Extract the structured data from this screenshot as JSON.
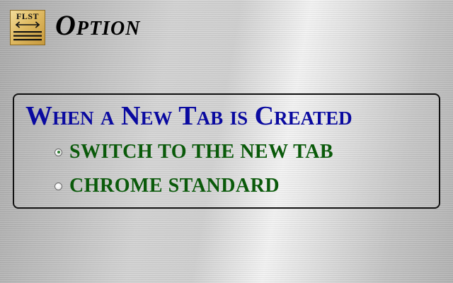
{
  "header": {
    "logo_text": "FLST",
    "title": "Option"
  },
  "setting": {
    "heading": "When a New Tab is Created",
    "options": [
      {
        "label": "SWITCH TO THE NEW TAB",
        "selected": true
      },
      {
        "label": "CHROME STANDARD",
        "selected": false
      }
    ]
  },
  "colors": {
    "heading": "#0a0aa0",
    "option_text": "#0a5a0a",
    "logo": "#e0bb63"
  },
  "icons": {
    "logo": "double-arrow-logo-icon"
  }
}
